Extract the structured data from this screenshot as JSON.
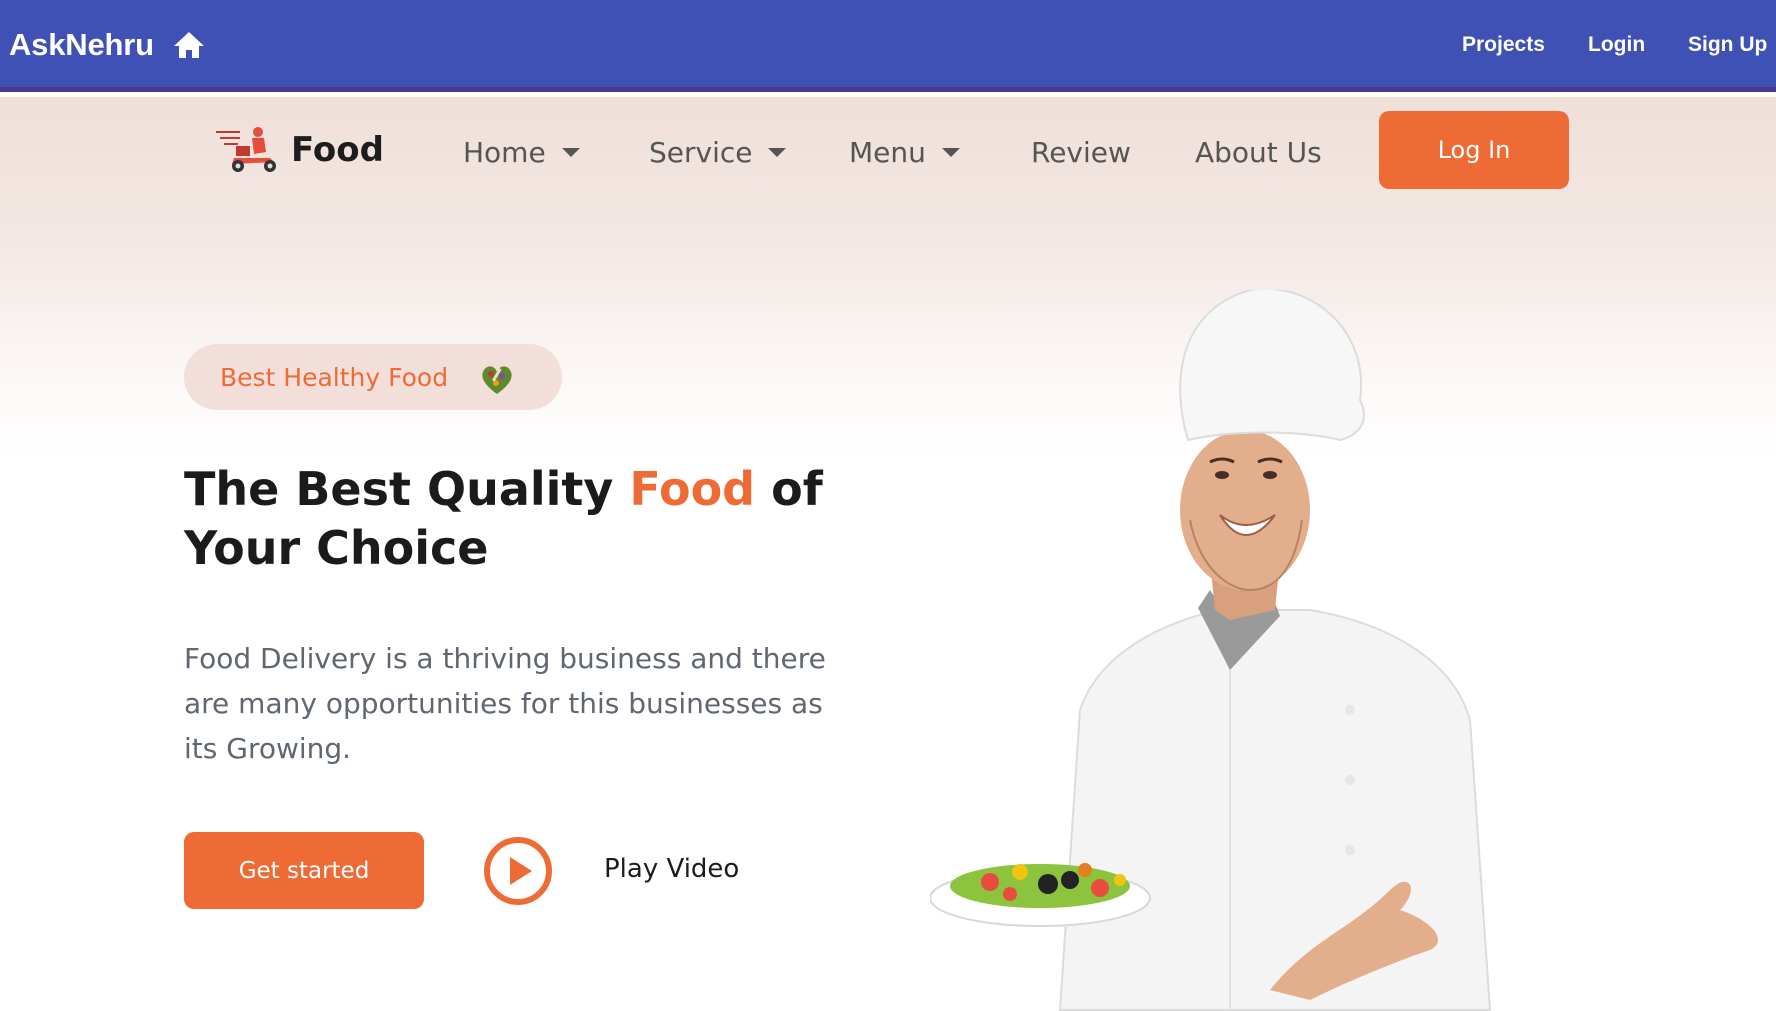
{
  "topbar": {
    "brand": "AskNehru",
    "home_icon": "home-icon",
    "links": [
      "Projects",
      "Login",
      "Sign Up"
    ]
  },
  "site_nav": {
    "logo_text": "Food",
    "logo_icon": "scooter-delivery-icon",
    "items": [
      {
        "label": "Home",
        "dropdown": true
      },
      {
        "label": "Service",
        "dropdown": true
      },
      {
        "label": "Menu",
        "dropdown": true
      },
      {
        "label": "Review",
        "dropdown": false
      },
      {
        "label": "About Us",
        "dropdown": false
      }
    ],
    "login_label": "Log In"
  },
  "hero": {
    "badge_text": "Best Healthy Food",
    "badge_icon": "vegetable-heart-icon",
    "headline_part1": "The Best Quality",
    "headline_accent": "Food",
    "headline_part2": "of Your Choice",
    "description": "Food Delivery is a thriving business and there are many opportunities for this businesses as its Growing.",
    "cta_label": "Get started",
    "play_label": "Play Video",
    "play_icon": "play-circle-icon"
  },
  "colors": {
    "topbar": "#3f51b5",
    "accent": "#ee6b35",
    "heading": "#1b1b1b",
    "body_text": "#606770"
  }
}
